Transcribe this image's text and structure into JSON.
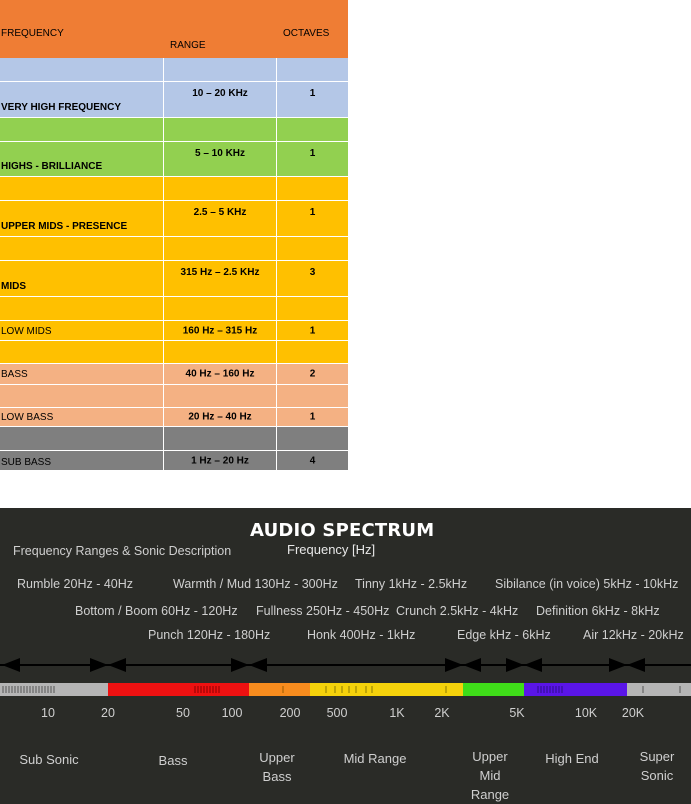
{
  "table": {
    "headers": {
      "frequency": "FREQUENCY",
      "range": "RANGE",
      "octaves": "OCTAVES"
    },
    "rows": [
      {
        "name": "VERY HIGH FREQUENCY",
        "range": "10 – 20 KHz",
        "octaves": "1"
      },
      {
        "name": "HIGHS - BRILLIANCE",
        "range": "5 – 10 KHz",
        "octaves": "1"
      },
      {
        "name": "UPPER MIDS - PRESENCE",
        "range": "2.5 – 5 KHz",
        "octaves": "1"
      },
      {
        "name": "MIDS",
        "range": "315 Hz – 2.5 KHz",
        "octaves": "3"
      },
      {
        "name": "LOW MIDS",
        "range": "160 Hz – 315 Hz",
        "octaves": "1"
      },
      {
        "name": "BASS",
        "range": "40 Hz – 160 Hz",
        "octaves": "2"
      },
      {
        "name": "LOW BASS",
        "range": "20 Hz – 40 Hz",
        "octaves": "1"
      },
      {
        "name": "SUB BASS",
        "range": "1 Hz – 20 Hz",
        "octaves": "4"
      }
    ],
    "colors": {
      "header": "#ef7d34",
      "blue": "#b4c7e7",
      "green": "#92d050",
      "amber": "#ffc000",
      "peach": "#f4b183",
      "gray": "#7f7f7f"
    }
  },
  "spectrum": {
    "title": "AUDIO SPECTRUM",
    "subtitle": "Frequency Ranges & Sonic Description",
    "axis_title": "Frequency [Hz]",
    "descriptions": {
      "row1": [
        "Rumble  20Hz - 40Hz",
        "Warmth / Mud 130Hz - 300Hz",
        "Tinny 1kHz - 2.5kHz",
        "Sibilance (in voice) 5kHz - 10kHz"
      ],
      "row2": [
        "Bottom / Boom 60Hz - 120Hz",
        "Fullness 250Hz - 450Hz",
        "Crunch 2.5kHz - 4kHz",
        "Definition 6kHz - 8kHz"
      ],
      "row3": [
        "Punch 120Hz - 180Hz",
        "Honk 400Hz - 1kHz",
        "Edge kHz - 6kHz",
        "Air 12kHz - 20kHz"
      ]
    },
    "hz_labels": [
      "10",
      "20",
      "50",
      "100",
      "200",
      "500",
      "1K",
      "2K",
      "5K",
      "10K",
      "20K"
    ],
    "regions": [
      "Sub Sonic",
      "Bass",
      "Upper\nBass",
      "Mid Range",
      "Upper\nMid\nRange",
      "High End",
      "Super\nSonic"
    ],
    "colors": {
      "background": "#2a2b27",
      "sub": "#b5b5b5",
      "bass": "#ee1111",
      "upper_bass": "#f78c1e",
      "mid": "#f5d20b",
      "upper_mid": "#3fdd19",
      "high": "#5a15e8",
      "super": "#b5b5b5"
    }
  }
}
